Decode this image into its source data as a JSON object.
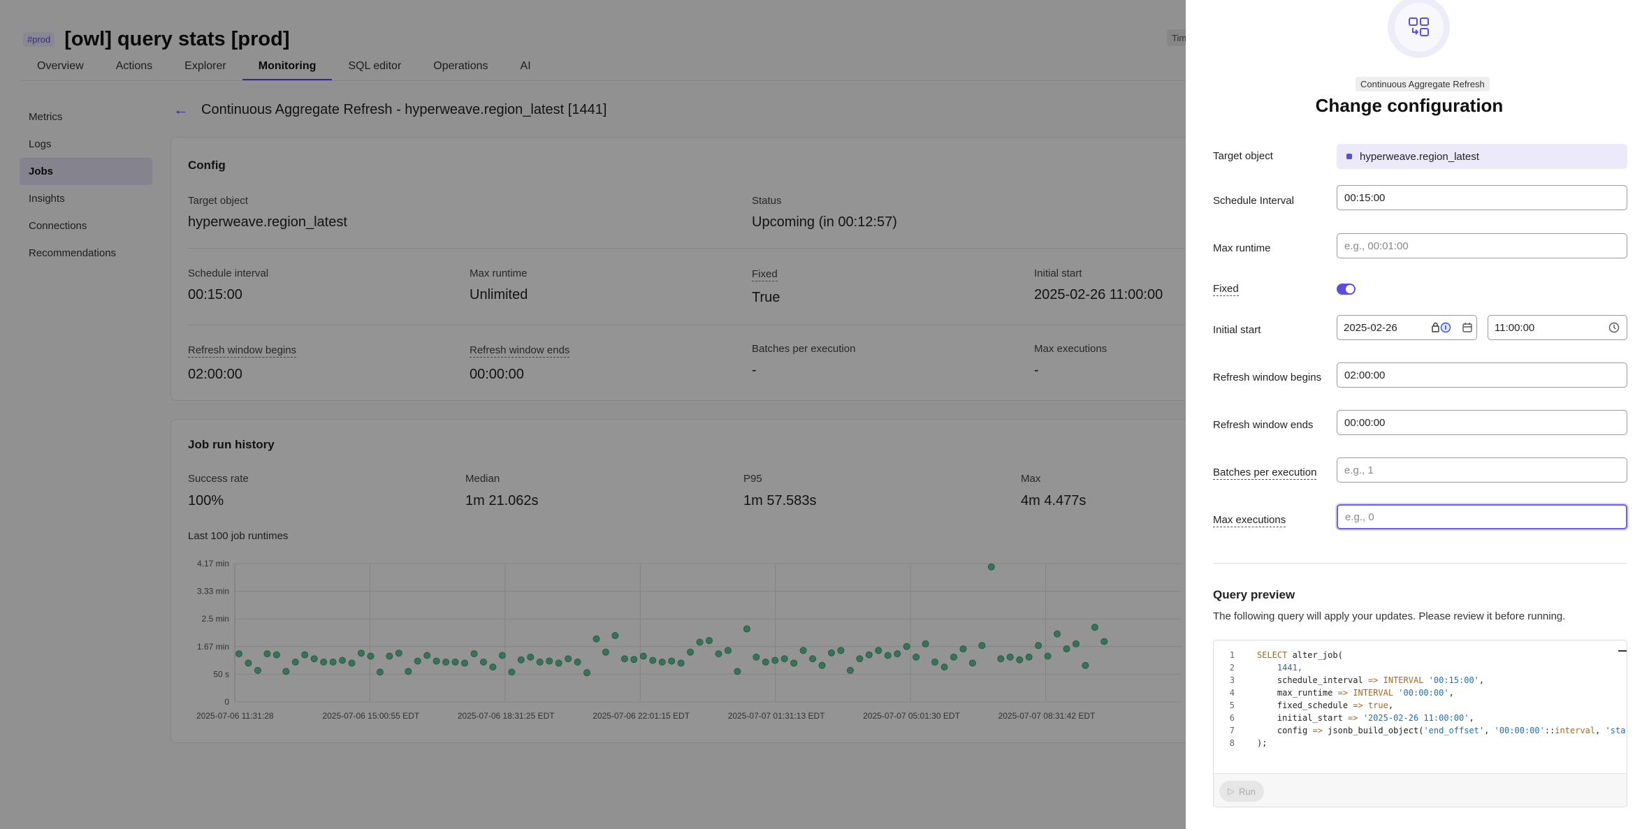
{
  "header": {
    "env_badge": "#prod",
    "title": "[owl] query stats [prod]",
    "tz_button": "Tim"
  },
  "tabs": [
    "Overview",
    "Actions",
    "Explorer",
    "Monitoring",
    "SQL editor",
    "Operations",
    "AI"
  ],
  "sidebar": [
    "Metrics",
    "Logs",
    "Jobs",
    "Insights",
    "Connections",
    "Recommendations"
  ],
  "page_title": "Continuous Aggregate Refresh - hyperweave.region_latest [1441]",
  "config": {
    "title": "Config",
    "target_label": "Target object",
    "target_value": "hyperweave.region_latest",
    "status_label": "Status",
    "status_value": "Upcoming (in 00:12:57)",
    "schedule_label": "Schedule interval",
    "schedule_value": "00:15:00",
    "maxrun_label": "Max runtime",
    "maxrun_value": "Unlimited",
    "fixed_label": "Fixed",
    "fixed_value": "True",
    "initial_label": "Initial start",
    "initial_value": "2025-02-26 11:00:00",
    "rwb_label": "Refresh window begins",
    "rwb_value": "02:00:00",
    "rwe_label": "Refresh window ends",
    "rwe_value": "00:00:00",
    "batches_label": "Batches per execution",
    "batches_value": "-",
    "maxexec_label": "Max executions",
    "maxexec_value": "-"
  },
  "history": {
    "title": "Job run history",
    "success_label": "Success rate",
    "success_value": "100%",
    "median_label": "Median",
    "median_value": "1m 21.062s",
    "p95_label": "P95",
    "p95_value": "1m 57.583s",
    "max_label": "Max",
    "max_value": "4m 4.477s",
    "chart_title": "Last 100 job runtimes"
  },
  "chart_data": {
    "type": "scatter",
    "title": "Last 100 job runtimes",
    "y_ticks": [
      "4.17 min",
      "3.33 min",
      "2.5 min",
      "1.67 min",
      "50 s",
      "0"
    ],
    "ylim_minutes": [
      0,
      4.17
    ],
    "x_ticks": [
      "2025-07-06 11:31:28",
      "2025-07-06 15:00:55 EDT",
      "2025-07-06 18:31:25 EDT",
      "2025-07-06 22:01:15 EDT",
      "2025-07-07 01:31:13 EDT",
      "2025-07-07 05:01:30 EDT",
      "2025-07-07 08:31:42 EDT"
    ],
    "grid": true,
    "series": [
      {
        "values_minutes": [
          1.45,
          1.17,
          0.95,
          1.45,
          1.42,
          0.92,
          1.2,
          1.42,
          1.3,
          1.2,
          1.2,
          1.25,
          1.17,
          1.47,
          1.38,
          0.9,
          1.38,
          1.47,
          0.92,
          1.23,
          1.4,
          1.23,
          1.2,
          1.2,
          1.17,
          1.45,
          1.2,
          1.05,
          1.4,
          0.9,
          1.27,
          1.35,
          1.2,
          1.23,
          1.17,
          1.3,
          1.2,
          0.88,
          1.9,
          1.5,
          2.0,
          1.3,
          1.28,
          1.38,
          1.25,
          1.2,
          1.23,
          1.17,
          1.5,
          1.8,
          1.85,
          1.45,
          1.55,
          0.92,
          2.2,
          1.35,
          1.2,
          1.25,
          1.3,
          1.17,
          1.55,
          1.3,
          1.1,
          1.48,
          1.55,
          0.95,
          1.3,
          1.42,
          1.55,
          1.4,
          1.45,
          1.67,
          1.35,
          1.75,
          1.2,
          1.05,
          1.35,
          1.6,
          1.17,
          1.7,
          4.07,
          1.3,
          1.35,
          1.27,
          1.35,
          1.7,
          1.38,
          2.05,
          1.6,
          1.75,
          1.1,
          2.25,
          1.82
        ]
      }
    ]
  },
  "drawer": {
    "badge": "Continuous Aggregate Refresh",
    "title": "Change configuration",
    "target_label": "Target object",
    "target_value": "hyperweave.region_latest",
    "schedule_label": "Schedule Interval",
    "schedule_value": "00:15:00",
    "maxrun_label": "Max runtime",
    "maxrun_placeholder": "e.g., 00:01:00",
    "fixed_label": "Fixed",
    "initial_label": "Initial start",
    "initial_date": "2025-02-26",
    "initial_time": "11:00:00",
    "rwb_label": "Refresh window begins",
    "rwb_value": "02:00:00",
    "rwe_label": "Refresh window ends",
    "rwe_value": "00:00:00",
    "batches_label": "Batches per execution",
    "batches_placeholder": "e.g., 1",
    "maxexec_label": "Max executions",
    "maxexec_placeholder": "e.g., 0",
    "qp_title": "Query preview",
    "qp_desc": "The following query will apply your updates. Please review it before running.",
    "run_label": "Run",
    "code_lines": [
      "1",
      "2",
      "3",
      "4",
      "5",
      "6",
      "7",
      "8"
    ],
    "code": {
      "l1a": "SELECT",
      "l1b": " alter_job(",
      "l2": "    1441,",
      "l3a": "    schedule_interval ",
      "l3b": "=>",
      "l3c": " INTERVAL",
      "l3d": " '00:15:00'",
      "l3e": ",",
      "l4a": "    max_runtime ",
      "l4b": "=>",
      "l4c": " INTERVAL",
      "l4d": " '00:00:00'",
      "l4e": ",",
      "l5a": "    fixed_schedule ",
      "l5b": "=>",
      "l5c": " true",
      "l5d": ",",
      "l6a": "    initial_start ",
      "l6b": "=>",
      "l6c": " '2025-02-26 11:00:00'",
      "l6d": ",",
      "l7a": "    config ",
      "l7b": "=>",
      "l7c": " jsonb_build_object(",
      "l7d": "'end_offset'",
      "l7e": ", ",
      "l7f": "'00:00:00'",
      "l7g": "::",
      "l7h": "interval",
      "l7i": ", ",
      "l7j": "'sta",
      "l8": ");"
    }
  }
}
